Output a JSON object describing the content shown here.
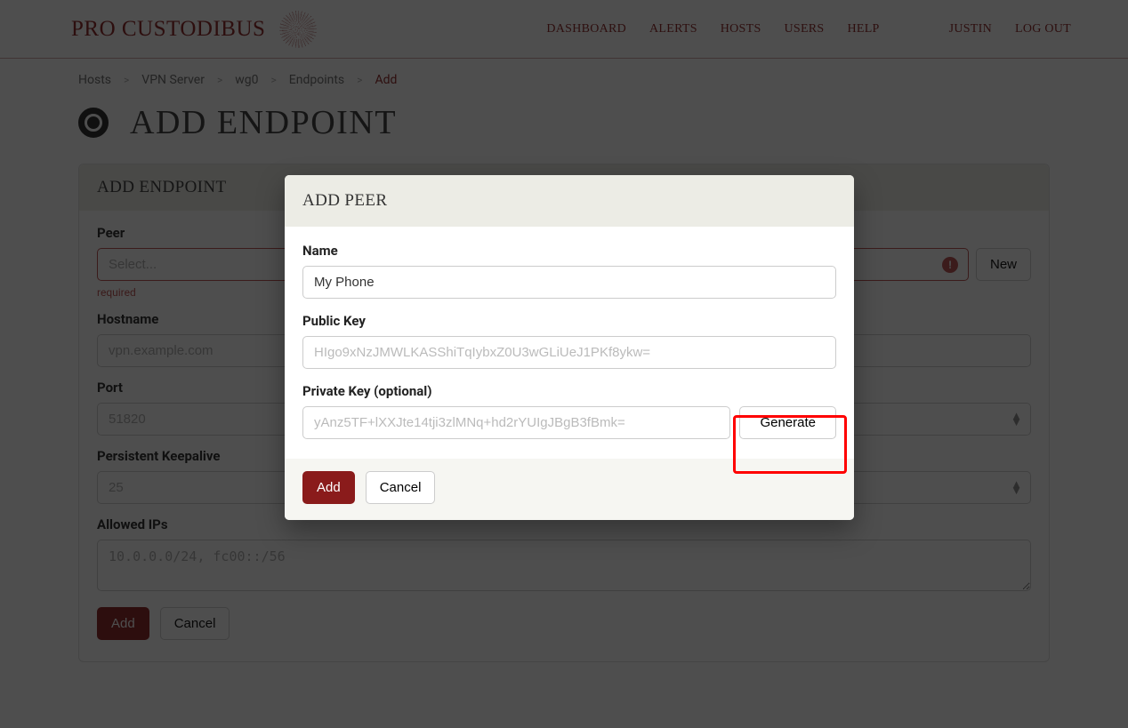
{
  "brand": {
    "name": "PRO CUSTODIBUS"
  },
  "nav": {
    "items": [
      "DASHBOARD",
      "ALERTS",
      "HOSTS",
      "USERS",
      "HELP"
    ],
    "user": "JUSTIN",
    "logout": "LOG OUT"
  },
  "breadcrumbs": {
    "items": [
      "Hosts",
      "VPN Server",
      "wg0",
      "Endpoints"
    ],
    "current": "Add",
    "sep": ">"
  },
  "page": {
    "title": "ADD ENDPOINT"
  },
  "endpoint_card": {
    "title": "ADD ENDPOINT",
    "peer": {
      "label": "Peer",
      "placeholder": "Select...",
      "required_hint": "required",
      "new_btn": "New"
    },
    "hostname": {
      "label": "Hostname",
      "placeholder": "vpn.example.com"
    },
    "port": {
      "label": "Port",
      "placeholder": "51820"
    },
    "keepalive": {
      "label": "Persistent Keepalive",
      "placeholder": "25"
    },
    "allowed_ips": {
      "label": "Allowed IPs",
      "placeholder": "10.0.0.0/24, fc00::/56"
    },
    "add_btn": "Add",
    "cancel_btn": "Cancel"
  },
  "peer_modal": {
    "title": "ADD PEER",
    "name": {
      "label": "Name",
      "value": "My Phone"
    },
    "pubkey": {
      "label": "Public Key",
      "value": "HIgo9xNzJMWLKASShiTqIybxZ0U3wGLiUeJ1PKf8ykw="
    },
    "privkey": {
      "label": "Private Key (optional)",
      "value": "yAnz5TF+lXXJte14tji3zlMNq+hd2rYUIgJBgB3fBmk=",
      "generate_btn": "Generate"
    },
    "add_btn": "Add",
    "cancel_btn": "Cancel"
  }
}
